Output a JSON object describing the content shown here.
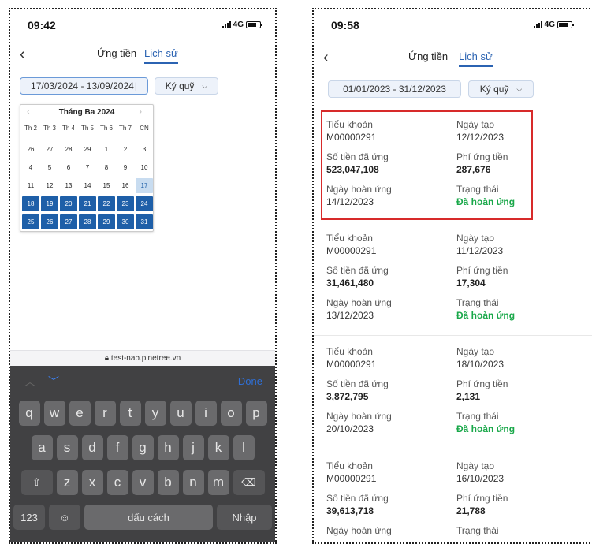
{
  "left": {
    "status": {
      "time": "09:42",
      "network": "4G"
    },
    "tabs": [
      "Ứng tiền",
      "Lịch sử"
    ],
    "date_range": "17/03/2024 - 13/09/2024",
    "account_select": "Ký quỹ",
    "calendar": {
      "month_label": "Tháng Ba 2024",
      "prev_icon": "‹",
      "next_icon": "›",
      "weekdays": [
        "Th 2",
        "Th 3",
        "Th 4",
        "Th 5",
        "Th 6",
        "Th 7",
        "CN"
      ],
      "rows": [
        [
          "26",
          "27",
          "28",
          "29",
          "1",
          "2",
          "3"
        ],
        [
          "4",
          "5",
          "6",
          "7",
          "8",
          "9",
          "10"
        ],
        [
          "11",
          "12",
          "13",
          "14",
          "15",
          "16",
          "17"
        ],
        [
          "18",
          "19",
          "20",
          "21",
          "22",
          "23",
          "24"
        ],
        [
          "25",
          "26",
          "27",
          "28",
          "29",
          "30",
          "31"
        ]
      ]
    },
    "url": "test-nab.pinetree.vn",
    "keyboard": {
      "done": "Done",
      "row1": [
        "q",
        "w",
        "e",
        "r",
        "t",
        "y",
        "u",
        "i",
        "o",
        "p"
      ],
      "row2": [
        "a",
        "s",
        "d",
        "f",
        "g",
        "h",
        "j",
        "k",
        "l"
      ],
      "row3": [
        "z",
        "x",
        "c",
        "v",
        "b",
        "n",
        "m"
      ],
      "numbers": "123",
      "space": "dấu cách",
      "return": "Nhập"
    }
  },
  "right": {
    "status": {
      "time": "09:58",
      "network": "4G"
    },
    "tabs": [
      "Ứng tiền",
      "Lịch sử"
    ],
    "date_range": "01/01/2023 - 31/12/2023",
    "account_select": "Ký quỹ",
    "labels": {
      "account": "Tiểu khoản",
      "created": "Ngày tạo",
      "amount": "Số tiền đã ứng",
      "fee": "Phí ứng tiền",
      "repay": "Ngày hoàn ứng",
      "status": "Trạng thái"
    },
    "records": [
      {
        "account": "M00000291",
        "created": "12/12/2023",
        "amount": "523,047,108",
        "fee": "287,676",
        "repay": "14/12/2023",
        "status": "Đã hoàn ứng"
      },
      {
        "account": "M00000291",
        "created": "11/12/2023",
        "amount": "31,461,480",
        "fee": "17,304",
        "repay": "13/12/2023",
        "status": "Đã hoàn ứng"
      },
      {
        "account": "M00000291",
        "created": "18/10/2023",
        "amount": "3,872,795",
        "fee": "2,131",
        "repay": "20/10/2023",
        "status": "Đã hoàn ứng"
      },
      {
        "account": "M00000291",
        "created": "16/10/2023",
        "amount": "39,613,718",
        "fee": "21,788",
        "repay": "",
        "status": ""
      }
    ]
  },
  "colors": {
    "accent": "#2b63b2",
    "selected_day": "#1e5fa8",
    "status_green": "#1aa84a",
    "highlight": "#d72a2a"
  }
}
